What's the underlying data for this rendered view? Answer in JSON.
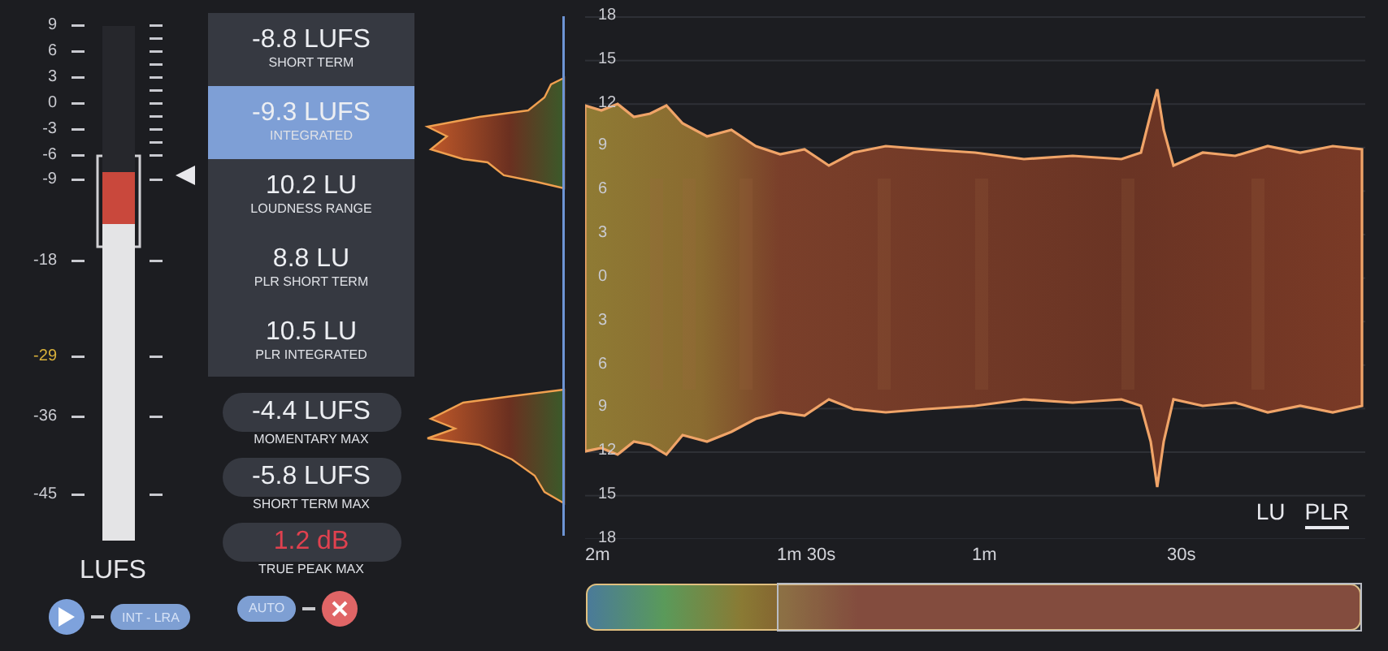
{
  "meter": {
    "scale": [
      {
        "label": "9",
        "kind": "normal"
      },
      {
        "label": "6",
        "kind": "normal"
      },
      {
        "label": "3",
        "kind": "normal"
      },
      {
        "label": "0",
        "kind": "normal"
      },
      {
        "label": "-3",
        "kind": "normal"
      },
      {
        "label": "-6",
        "kind": "normal"
      },
      {
        "label": "-9",
        "kind": "normal"
      },
      {
        "label": "-18",
        "kind": "normal"
      },
      {
        "label": "-29",
        "kind": "target"
      },
      {
        "label": "-36",
        "kind": "normal"
      },
      {
        "label": "-45",
        "kind": "normal"
      }
    ],
    "bars": [
      {
        "kind": "short_term",
        "level": 0.716
      },
      {
        "kind": "integrated",
        "level": 0.615
      }
    ],
    "unit": "LUFS"
  },
  "meter_controls": {
    "mode_button": "INT - LRA"
  },
  "readings": [
    {
      "value": "-8.8 LUFS",
      "label": "SHORT TERM",
      "selected": false
    },
    {
      "value": "-9.3 LUFS",
      "label": "INTEGRATED",
      "selected": true
    },
    {
      "value": "10.2 LU",
      "label": "LOUDNESS RANGE",
      "selected": false
    },
    {
      "value": "8.8 LU",
      "label": "PLR SHORT TERM",
      "selected": false
    },
    {
      "value": "10.5 LU",
      "label": "PLR INTEGRATED",
      "selected": false
    }
  ],
  "maxima": [
    {
      "value": "-4.4 LUFS",
      "label": "MOMENTARY MAX",
      "kind": "normal"
    },
    {
      "value": "-5.8 LUFS",
      "label": "SHORT TERM MAX",
      "kind": "normal"
    },
    {
      "value": "1.2 dB",
      "label": "TRUE PEAK MAX",
      "kind": "alert"
    }
  ],
  "reset_controls": {
    "auto_button": "AUTO"
  },
  "history": {
    "y_labels": [
      "18",
      "15",
      "12",
      "9",
      "6",
      "3",
      "0",
      "3",
      "6",
      "9",
      "12",
      "15",
      "18"
    ],
    "time_labels": [
      "2m",
      "1m 30s",
      "1m",
      "30s"
    ],
    "scale_toggle": [
      {
        "label": "LU",
        "selected": false
      },
      {
        "label": "PLR",
        "selected": true
      }
    ]
  }
}
